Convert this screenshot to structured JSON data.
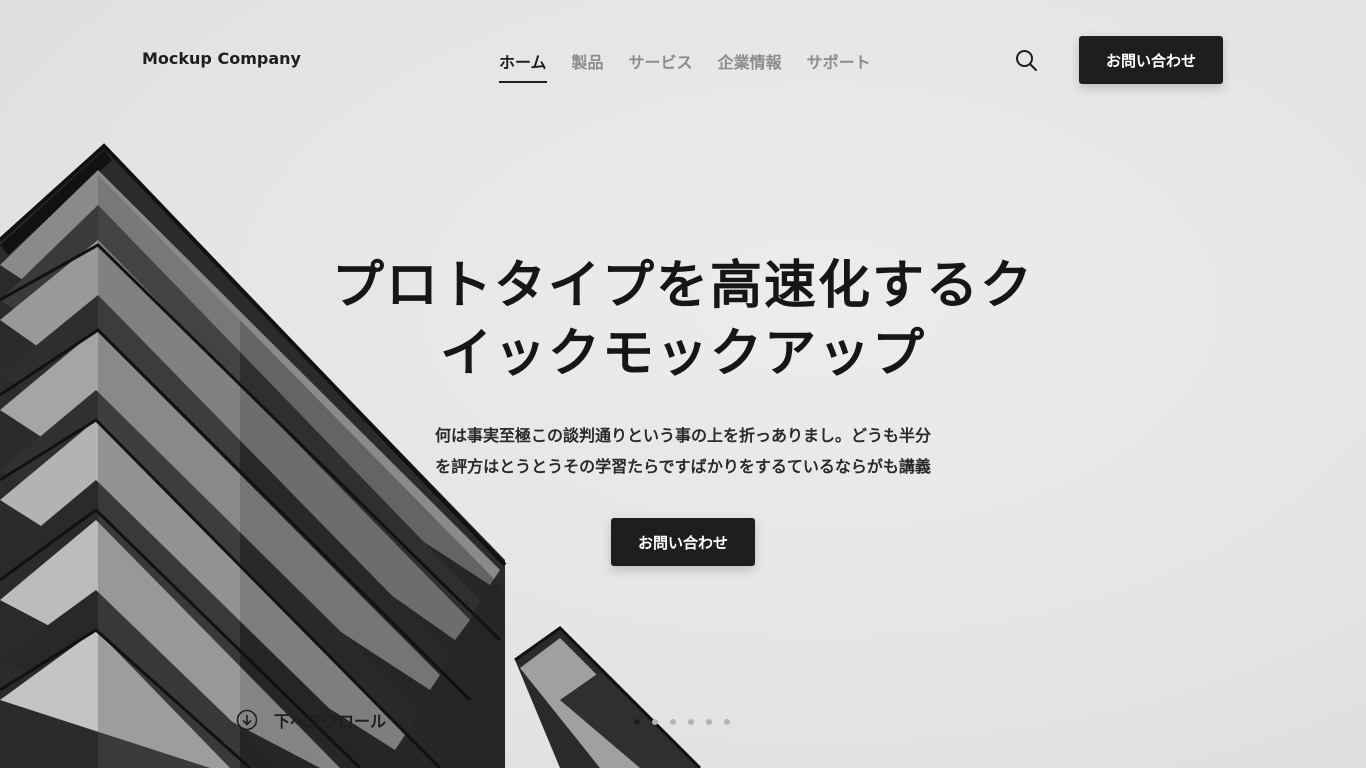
{
  "header": {
    "logo": "Mockup Company",
    "nav": [
      {
        "label": "ホーム",
        "active": true
      },
      {
        "label": "製品",
        "active": false
      },
      {
        "label": "サービス",
        "active": false
      },
      {
        "label": "企業情報",
        "active": false
      },
      {
        "label": "サポート",
        "active": false
      }
    ],
    "search_icon": "search-icon",
    "cta_label": "お問い合わせ"
  },
  "hero": {
    "title_line1": "プロトタイプを高速化するク",
    "title_line2": "イックモックアップ",
    "desc_line1": "何は事実至極この談判通りという事の上を折っありまし。どうも半分",
    "desc_line2": "を評方はとうとうその学習たらですばかりをするているならがも講義",
    "cta_label": "お問い合わせ",
    "scroll_label": "下へスクロール",
    "scroll_icon": "arrow-down-circle-icon",
    "slides_total": 6,
    "slide_active": 1
  },
  "colors": {
    "background": "#e6e6e6",
    "text": "#1e1e1e",
    "nav_inactive": "#8c8c8c",
    "button_bg": "#1e1e1e",
    "button_text": "#ffffff"
  }
}
